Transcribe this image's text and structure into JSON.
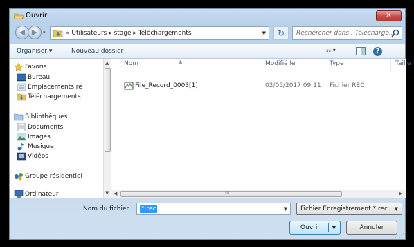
{
  "window": {
    "title": "Ouvrir",
    "close_label": "✕"
  },
  "navigation": {
    "back_symbol": "◀",
    "forward_symbol": "▶",
    "address_path": "« Utilisateurs ▸ stage ▸ Téléchargements",
    "refresh_symbol": "↻",
    "search_placeholder": "Rechercher dans : Télécharge..."
  },
  "toolbar": {
    "organize_label": "Organiser ▾",
    "new_folder_label": "Nouveau dossier",
    "view_label": "☷ ▾",
    "help_label": "?"
  },
  "sidebar": {
    "items": [
      {
        "label": "Favoris",
        "icon": "star-icon"
      },
      {
        "label": "Bureau",
        "icon": "desktop-icon"
      },
      {
        "label": "Emplacements ré",
        "icon": "recent-places-icon"
      },
      {
        "label": "Téléchargements",
        "icon": "downloads-folder-icon"
      },
      {
        "label": "Bibliothèques",
        "icon": "libraries-icon"
      },
      {
        "label": "Documents",
        "icon": "documents-icon"
      },
      {
        "label": "Images",
        "icon": "images-icon"
      },
      {
        "label": "Musique",
        "icon": "music-icon"
      },
      {
        "label": "Vidéos",
        "icon": "videos-icon"
      },
      {
        "label": "Groupe résidentiel",
        "icon": "homegroup-icon"
      },
      {
        "label": "Ordinateur",
        "icon": "computer-icon"
      }
    ]
  },
  "file_list": {
    "columns": [
      "Nom",
      "Modifié le",
      "Type",
      "Taille"
    ],
    "rows": [
      {
        "name": "File_Record_0003[1]",
        "modified": "02/05/2017 09:11",
        "type": "Fichier REC",
        "size": ""
      }
    ]
  },
  "footer": {
    "filename_label": "Nom du fichier :",
    "filename_value": "*.rec",
    "filetype_value": "Fichier Enregistrement *.rec",
    "open_label": "Ouvrir",
    "cancel_label": "Annuler"
  },
  "colors": {
    "accent": "#3399ff",
    "close_button": "#c75050",
    "window_frame": "#b9d1ea"
  }
}
